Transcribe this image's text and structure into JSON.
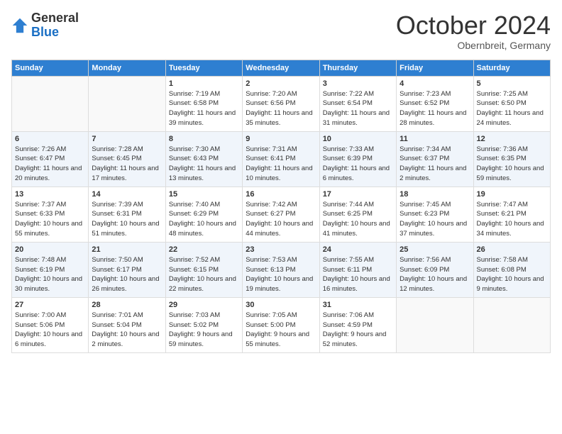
{
  "header": {
    "logo_line1": "General",
    "logo_line2": "Blue",
    "month_title": "October 2024",
    "location": "Obernbreit, Germany"
  },
  "weekdays": [
    "Sunday",
    "Monday",
    "Tuesday",
    "Wednesday",
    "Thursday",
    "Friday",
    "Saturday"
  ],
  "weeks": [
    [
      {
        "day": "",
        "empty": true
      },
      {
        "day": "",
        "empty": true
      },
      {
        "day": "1",
        "sunrise": "Sunrise: 7:19 AM",
        "sunset": "Sunset: 6:58 PM",
        "daylight": "Daylight: 11 hours and 39 minutes."
      },
      {
        "day": "2",
        "sunrise": "Sunrise: 7:20 AM",
        "sunset": "Sunset: 6:56 PM",
        "daylight": "Daylight: 11 hours and 35 minutes."
      },
      {
        "day": "3",
        "sunrise": "Sunrise: 7:22 AM",
        "sunset": "Sunset: 6:54 PM",
        "daylight": "Daylight: 11 hours and 31 minutes."
      },
      {
        "day": "4",
        "sunrise": "Sunrise: 7:23 AM",
        "sunset": "Sunset: 6:52 PM",
        "daylight": "Daylight: 11 hours and 28 minutes."
      },
      {
        "day": "5",
        "sunrise": "Sunrise: 7:25 AM",
        "sunset": "Sunset: 6:50 PM",
        "daylight": "Daylight: 11 hours and 24 minutes."
      }
    ],
    [
      {
        "day": "6",
        "sunrise": "Sunrise: 7:26 AM",
        "sunset": "Sunset: 6:47 PM",
        "daylight": "Daylight: 11 hours and 20 minutes."
      },
      {
        "day": "7",
        "sunrise": "Sunrise: 7:28 AM",
        "sunset": "Sunset: 6:45 PM",
        "daylight": "Daylight: 11 hours and 17 minutes."
      },
      {
        "day": "8",
        "sunrise": "Sunrise: 7:30 AM",
        "sunset": "Sunset: 6:43 PM",
        "daylight": "Daylight: 11 hours and 13 minutes."
      },
      {
        "day": "9",
        "sunrise": "Sunrise: 7:31 AM",
        "sunset": "Sunset: 6:41 PM",
        "daylight": "Daylight: 11 hours and 10 minutes."
      },
      {
        "day": "10",
        "sunrise": "Sunrise: 7:33 AM",
        "sunset": "Sunset: 6:39 PM",
        "daylight": "Daylight: 11 hours and 6 minutes."
      },
      {
        "day": "11",
        "sunrise": "Sunrise: 7:34 AM",
        "sunset": "Sunset: 6:37 PM",
        "daylight": "Daylight: 11 hours and 2 minutes."
      },
      {
        "day": "12",
        "sunrise": "Sunrise: 7:36 AM",
        "sunset": "Sunset: 6:35 PM",
        "daylight": "Daylight: 10 hours and 59 minutes."
      }
    ],
    [
      {
        "day": "13",
        "sunrise": "Sunrise: 7:37 AM",
        "sunset": "Sunset: 6:33 PM",
        "daylight": "Daylight: 10 hours and 55 minutes."
      },
      {
        "day": "14",
        "sunrise": "Sunrise: 7:39 AM",
        "sunset": "Sunset: 6:31 PM",
        "daylight": "Daylight: 10 hours and 51 minutes."
      },
      {
        "day": "15",
        "sunrise": "Sunrise: 7:40 AM",
        "sunset": "Sunset: 6:29 PM",
        "daylight": "Daylight: 10 hours and 48 minutes."
      },
      {
        "day": "16",
        "sunrise": "Sunrise: 7:42 AM",
        "sunset": "Sunset: 6:27 PM",
        "daylight": "Daylight: 10 hours and 44 minutes."
      },
      {
        "day": "17",
        "sunrise": "Sunrise: 7:44 AM",
        "sunset": "Sunset: 6:25 PM",
        "daylight": "Daylight: 10 hours and 41 minutes."
      },
      {
        "day": "18",
        "sunrise": "Sunrise: 7:45 AM",
        "sunset": "Sunset: 6:23 PM",
        "daylight": "Daylight: 10 hours and 37 minutes."
      },
      {
        "day": "19",
        "sunrise": "Sunrise: 7:47 AM",
        "sunset": "Sunset: 6:21 PM",
        "daylight": "Daylight: 10 hours and 34 minutes."
      }
    ],
    [
      {
        "day": "20",
        "sunrise": "Sunrise: 7:48 AM",
        "sunset": "Sunset: 6:19 PM",
        "daylight": "Daylight: 10 hours and 30 minutes."
      },
      {
        "day": "21",
        "sunrise": "Sunrise: 7:50 AM",
        "sunset": "Sunset: 6:17 PM",
        "daylight": "Daylight: 10 hours and 26 minutes."
      },
      {
        "day": "22",
        "sunrise": "Sunrise: 7:52 AM",
        "sunset": "Sunset: 6:15 PM",
        "daylight": "Daylight: 10 hours and 22 minutes."
      },
      {
        "day": "23",
        "sunrise": "Sunrise: 7:53 AM",
        "sunset": "Sunset: 6:13 PM",
        "daylight": "Daylight: 10 hours and 19 minutes."
      },
      {
        "day": "24",
        "sunrise": "Sunrise: 7:55 AM",
        "sunset": "Sunset: 6:11 PM",
        "daylight": "Daylight: 10 hours and 16 minutes."
      },
      {
        "day": "25",
        "sunrise": "Sunrise: 7:56 AM",
        "sunset": "Sunset: 6:09 PM",
        "daylight": "Daylight: 10 hours and 12 minutes."
      },
      {
        "day": "26",
        "sunrise": "Sunrise: 7:58 AM",
        "sunset": "Sunset: 6:08 PM",
        "daylight": "Daylight: 10 hours and 9 minutes."
      }
    ],
    [
      {
        "day": "27",
        "sunrise": "Sunrise: 7:00 AM",
        "sunset": "Sunset: 5:06 PM",
        "daylight": "Daylight: 10 hours and 6 minutes."
      },
      {
        "day": "28",
        "sunrise": "Sunrise: 7:01 AM",
        "sunset": "Sunset: 5:04 PM",
        "daylight": "Daylight: 10 hours and 2 minutes."
      },
      {
        "day": "29",
        "sunrise": "Sunrise: 7:03 AM",
        "sunset": "Sunset: 5:02 PM",
        "daylight": "Daylight: 9 hours and 59 minutes."
      },
      {
        "day": "30",
        "sunrise": "Sunrise: 7:05 AM",
        "sunset": "Sunset: 5:00 PM",
        "daylight": "Daylight: 9 hours and 55 minutes."
      },
      {
        "day": "31",
        "sunrise": "Sunrise: 7:06 AM",
        "sunset": "Sunset: 4:59 PM",
        "daylight": "Daylight: 9 hours and 52 minutes."
      },
      {
        "day": "",
        "empty": true
      },
      {
        "day": "",
        "empty": true
      }
    ]
  ]
}
